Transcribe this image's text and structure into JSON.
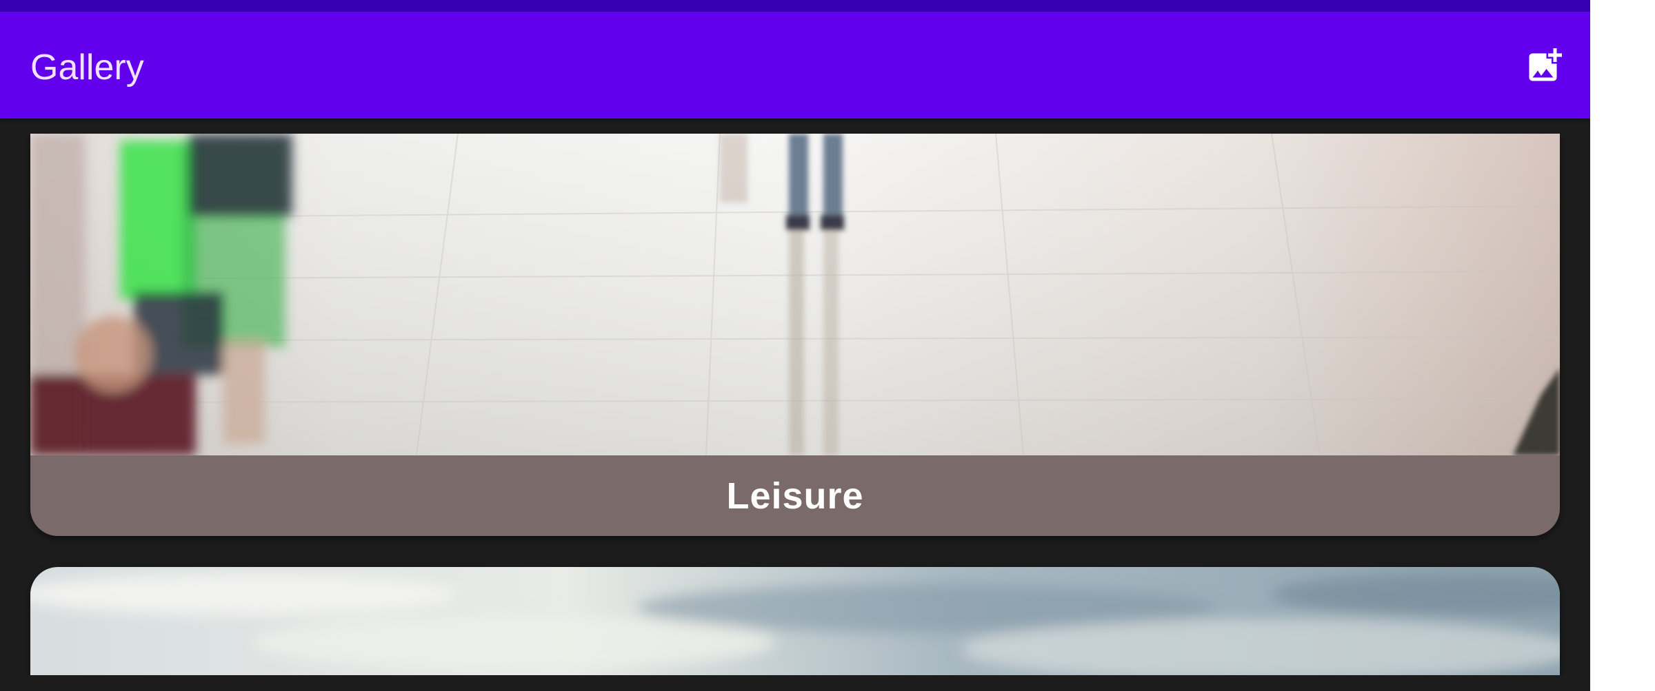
{
  "app_bar": {
    "title": "Gallery",
    "action_icon": "add-photo-icon"
  },
  "colors": {
    "status_bar": "#3700b3",
    "app_bar": "#6200ee",
    "title_text": "#f1e3ff",
    "background": "#1c1c1c",
    "caption_background": "#7b6a6a"
  },
  "gallery": {
    "cards": [
      {
        "caption": "Leisure",
        "image": "people-walking-floor-photo"
      },
      {
        "caption": "",
        "image": "cloudy-sky-photo"
      }
    ]
  }
}
